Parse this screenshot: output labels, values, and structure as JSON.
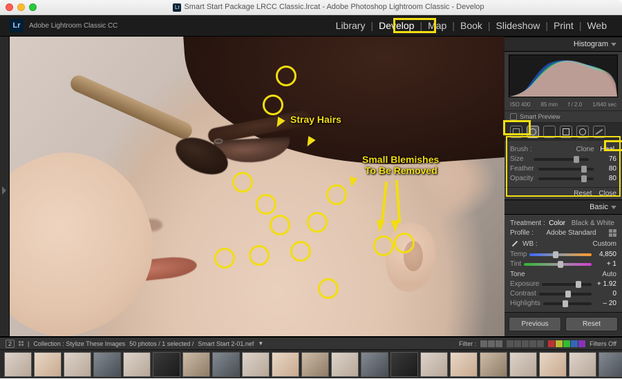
{
  "window": {
    "title": "Smart Start Package LRCC Classic.lrcat - Adobe Photoshop Lightroom Classic - Develop"
  },
  "app_name": "Adobe Lightroom Classic CC",
  "modules": {
    "items": [
      "Library",
      "Develop",
      "Map",
      "Book",
      "Slideshow",
      "Print",
      "Web"
    ],
    "selected": "Develop"
  },
  "annotations": {
    "stray_hairs": "Stray Hairs",
    "blemishes_l1": "Small Blemishes",
    "blemishes_l2": "To Be Removed"
  },
  "rightPanel": {
    "histogram_label": "Histogram",
    "histInfo": {
      "iso": "ISO 400",
      "lens": "85 mm",
      "ap": "f / 2.0",
      "sh": "1/640 sec"
    },
    "smart_preview": "Smart Preview",
    "brush": {
      "label": "Brush :",
      "clone": "Clone",
      "heal": "Heal",
      "size_lbl": "Size",
      "size": "76",
      "feather_lbl": "Feather",
      "feather": "80",
      "opacity_lbl": "Opacity",
      "opacity": "80",
      "reset": "Reset",
      "close": "Close"
    },
    "basic": {
      "header": "Basic",
      "treatment_lbl": "Treatment :",
      "color": "Color",
      "bw": "Black & White",
      "profile_lbl": "Profile :",
      "profile": "Adobe Standard",
      "wb_lbl": "WB :",
      "wb": "Custom",
      "temp_lbl": "Temp",
      "temp": "4,850",
      "tint_lbl": "Tint",
      "tint": "+ 1",
      "tone_lbl": "Tone",
      "auto": "Auto",
      "exposure_lbl": "Exposure",
      "exposure": "+ 1.92",
      "contrast_lbl": "Contrast",
      "contrast": "0",
      "highlights_lbl": "Highlights",
      "highlights": "– 20"
    },
    "prev": "Previous",
    "reset": "Reset"
  },
  "footer": {
    "nav1": "2",
    "collection": "Collection : Stylize These Images",
    "count": "50 photos / 1 selected /",
    "file": "Smart Start 2-01.nef",
    "filter_lbl": "Filter :",
    "filters_off": "Filters Off"
  }
}
